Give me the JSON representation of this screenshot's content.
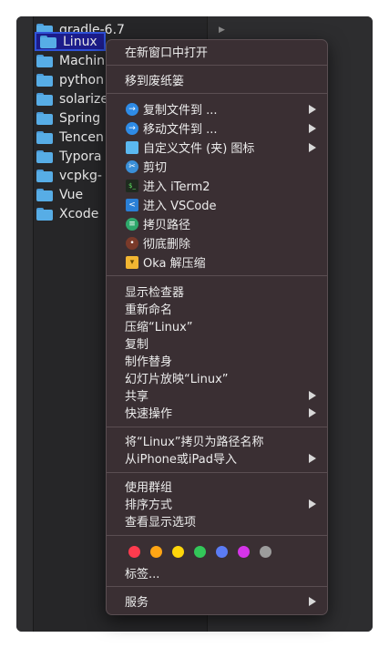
{
  "finder": {
    "files": [
      {
        "name": "gradle-6.7",
        "arrow": "▶"
      },
      {
        "name": "Linux",
        "selected": true
      },
      {
        "name": "Machin"
      },
      {
        "name": "python"
      },
      {
        "name": "solarize"
      },
      {
        "name": "Spring"
      },
      {
        "name": "Tencen"
      },
      {
        "name": "Typora"
      },
      {
        "name": "vcpkg-"
      },
      {
        "name": "Vue"
      },
      {
        "name": "Xcode"
      }
    ]
  },
  "menu": {
    "open_new_window": "在新窗口中打开",
    "move_to_trash": "移到废纸篓",
    "copy_to": "复制文件到 ...",
    "move_to": "移动文件到 ...",
    "custom_icon": "自定义文件 (夹) 图标",
    "cut": "剪切",
    "open_iterm": "进入 iTerm2",
    "open_vscode": "进入 VSCode",
    "copy_path": "拷贝路径",
    "delete_permanently": "彻底删除",
    "oka_unzip": "Oka 解压缩",
    "get_info": "显示检查器",
    "rename": "重新命名",
    "compress": "压缩“Linux”",
    "duplicate": "复制",
    "make_alias": "制作替身",
    "slideshow": "幻灯片放映“Linux”",
    "share": "共享",
    "quick_actions": "快速操作",
    "copy_as_pathname": "将“Linux”拷贝为路径名称",
    "import_from_iphone": "从iPhone或iPad导入",
    "use_groups": "使用群组",
    "sort_by": "排序方式",
    "show_view_options": "查看显示选项",
    "tags_label": "标签...",
    "services": "服务"
  },
  "tag_colors": [
    "#ff3b4e",
    "#ffa514",
    "#ffd60a",
    "#33c759",
    "#5b7cf5",
    "#d534e8",
    "#9c9c9c"
  ],
  "icon_colors": {
    "copy": "#2e8be6",
    "move": "#2e8be6",
    "custom": "#5bb8f0",
    "cut": "#3a8fd8",
    "iterm": "#1f2a1f",
    "vscode": "#2a7fd6",
    "path": "#2ea86b",
    "delete": "#7a3a2a",
    "oka": "#f2b632"
  }
}
